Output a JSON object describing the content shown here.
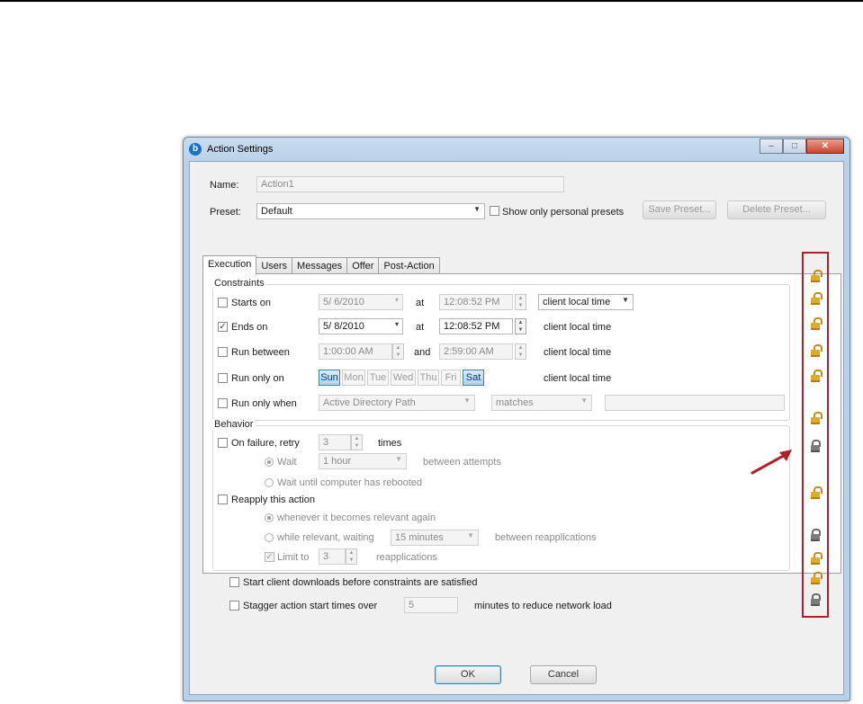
{
  "window": {
    "title": "Action Settings",
    "app_icon": "b"
  },
  "name_label": "Name:",
  "name_value": "Action1",
  "preset_label": "Preset:",
  "preset_value": "Default",
  "show_personal_label": "Show only personal presets",
  "save_preset": "Save Preset...",
  "delete_preset": "Delete Preset...",
  "tabs": [
    "Execution",
    "Users",
    "Messages",
    "Offer",
    "Post-Action"
  ],
  "constraints": {
    "title": "Constraints",
    "starts_on": {
      "label": "Starts on",
      "checked": false,
      "date": "5/ 6/2010",
      "at": "at",
      "time": "12:08:52 PM",
      "tz": "client local time"
    },
    "ends_on": {
      "label": "Ends on",
      "checked": true,
      "date": "5/ 8/2010",
      "at": "at",
      "time": "12:08:52 PM",
      "tz": "client local time"
    },
    "run_between": {
      "label": "Run between",
      "checked": false,
      "start": "1:00:00 AM",
      "and": "and",
      "end": "2:59:00 AM",
      "tz": "client local time"
    },
    "run_only_on": {
      "label": "Run only on",
      "checked": false,
      "days": [
        "Sun",
        "Mon",
        "Tue",
        "Wed",
        "Thu",
        "Fri",
        "Sat"
      ],
      "selected": [
        "Sun",
        "Sat"
      ],
      "tz": "client local time"
    },
    "run_only_when": {
      "label": "Run only when",
      "checked": false,
      "property": "Active Directory Path",
      "operator": "matches",
      "value": ""
    }
  },
  "behavior": {
    "title": "Behavior",
    "on_failure": {
      "label": "On failure, retry",
      "checked": false,
      "count": "3",
      "times": "times"
    },
    "wait": {
      "label": "Wait",
      "value": "1 hour",
      "suffix": "between attempts"
    },
    "wait_reboot": {
      "label": "Wait until computer has rebooted"
    },
    "reapply": {
      "label": "Reapply this action",
      "checked": false
    },
    "whenever": {
      "label": "whenever it becomes relevant again"
    },
    "while_relevant": {
      "label": "while relevant, waiting",
      "value": "15 minutes",
      "suffix": "between reapplications"
    },
    "limit": {
      "label": "Limit to",
      "checked": true,
      "value": "3",
      "suffix": "reapplications"
    },
    "start_downloads": {
      "label": "Start client downloads before constraints are satisfied",
      "checked": false
    },
    "stagger": {
      "label": "Stagger action start times over",
      "checked": false,
      "value": "5",
      "suffix": "minutes to reduce network load"
    }
  },
  "ok": "OK",
  "cancel": "Cancel",
  "locks": [
    "unlocked-gold",
    "unlocked-gold",
    "unlocked-gold",
    "unlocked-gold",
    "unlocked-gold",
    "unlocked-gold",
    "locked-gray",
    "unlocked-gold",
    "locked-gray",
    "unlocked-gold",
    "unlocked-gold",
    "locked-gray"
  ],
  "colors": {
    "highlight_box": "#b0202a",
    "arrow": "#b0202a",
    "lock_gold": "#e3a928",
    "lock_gray": "#7c7c7c"
  }
}
